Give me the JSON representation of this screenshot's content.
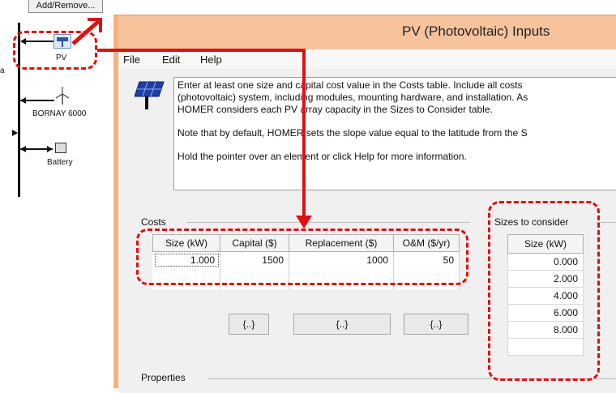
{
  "schematic": {
    "add_remove_label": "Add/Remove...",
    "bus_label": "a",
    "components": [
      {
        "label": "PV",
        "icon": "pv-panel-icon"
      },
      {
        "label": "BORNAY 6000",
        "icon": "wind-turbine-icon"
      },
      {
        "label": "Battery",
        "icon": "battery-icon"
      }
    ]
  },
  "window": {
    "title": "PV (Photovoltaic) Inputs",
    "menu": [
      "File",
      "Edit",
      "Help"
    ],
    "info_lines": [
      "Enter at least one size and capital cost value in the Costs table.  Include all costs",
      "(photovoltaic) system, including modules, mounting hardware, and installation. As",
      "HOMER considers each PV array capacity in the Sizes to Consider table.",
      "Note that by default, HOMER sets the slope value equal to the latitude from the S",
      "Hold the pointer over an element or click Help for more information."
    ],
    "costs": {
      "group_label": "Costs",
      "headers": [
        "Size (kW)",
        "Capital ($)",
        "Replacement ($)",
        "O&M ($/yr)"
      ],
      "row": [
        "1.000",
        "1500",
        "1000",
        "50"
      ],
      "buttons": [
        "{..}",
        "{..}",
        "{..}"
      ]
    },
    "sizes": {
      "group_label": "Sizes to consider",
      "header": "Size (kW)",
      "values": [
        "0.000",
        "2.000",
        "4.000",
        "6.000",
        "8.000"
      ]
    },
    "properties_label": "Properties"
  },
  "annotation_color": "#e01010"
}
